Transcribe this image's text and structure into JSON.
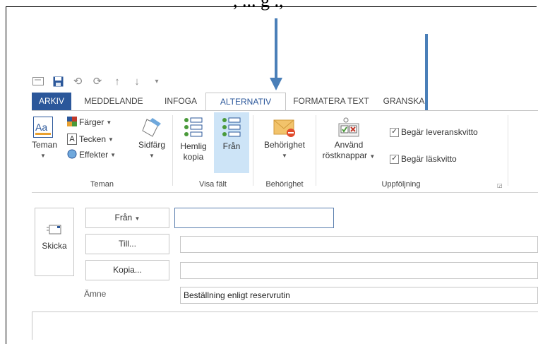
{
  "top_text": ", ... g ., ",
  "quick_access": {
    "icons": [
      "mail-icon",
      "save-icon",
      "undo-icon",
      "redo-icon",
      "up-icon",
      "down-icon",
      "customize-icon"
    ]
  },
  "tabs": [
    {
      "label": "ARKIV"
    },
    {
      "label": "MEDDELANDE"
    },
    {
      "label": "INFOGA"
    },
    {
      "label": "ALTERNATIV"
    },
    {
      "label": "FORMATERA TEXT"
    },
    {
      "label": "GRANSKA"
    }
  ],
  "ribbon": {
    "teman": {
      "label": "Teman",
      "themes_button": "Teman",
      "colors": "Färger",
      "fonts": "Tecken",
      "effects": "Effekter",
      "page_color": "Sidfärg"
    },
    "visa_falt": {
      "label": "Visa fält",
      "bcc_line1": "Hemlig",
      "bcc_line2": "kopia",
      "from": "Från"
    },
    "behorighet": {
      "label": "Behörighet",
      "permission_button": "Behörighet"
    },
    "uppfoljning": {
      "label": "Uppföljning",
      "voting_line1": "Använd",
      "voting_line2": "röstknappar",
      "delivery_receipt": "Begär leveranskvitto",
      "read_receipt": "Begär läskvitto"
    }
  },
  "compose": {
    "send": "Skicka",
    "from_button": "Från",
    "to_button": "Till...",
    "cc_button": "Kopia...",
    "subject_label": "Ämne",
    "from_value": "",
    "to_value": "",
    "cc_value": "",
    "subject_value": "Beställning enligt reservrutin"
  },
  "colors": {
    "file_tab": "#2b579a",
    "accent": "#2b579a",
    "arrow": "#4a7fb8",
    "selected_button": "#cde4f7"
  }
}
